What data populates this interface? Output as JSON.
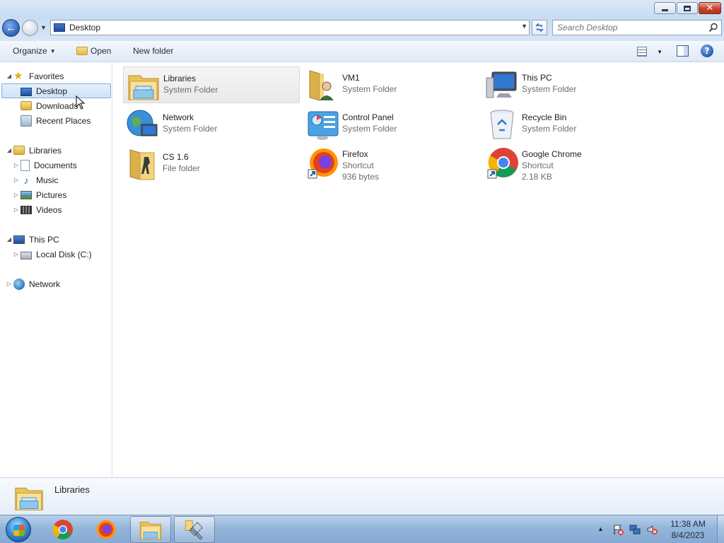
{
  "window": {
    "address": "Desktop",
    "search_placeholder": "Search Desktop"
  },
  "toolbar": {
    "organize_label": "Organize",
    "open_label": "Open",
    "new_folder_label": "New folder"
  },
  "navigation": {
    "favorites": {
      "label": "Favorites",
      "items": [
        {
          "label": "Desktop",
          "icon": "desktop-icon",
          "selected": true
        },
        {
          "label": "Downloads",
          "icon": "folder-icon"
        },
        {
          "label": "Recent Places",
          "icon": "recent-places-icon"
        }
      ]
    },
    "libraries": {
      "label": "Libraries",
      "items": [
        {
          "label": "Documents",
          "icon": "documents-icon"
        },
        {
          "label": "Music",
          "icon": "music-icon"
        },
        {
          "label": "Pictures",
          "icon": "pictures-icon"
        },
        {
          "label": "Videos",
          "icon": "videos-icon"
        }
      ]
    },
    "this_pc": {
      "label": "This PC",
      "items": [
        {
          "label": "Local Disk (C:)",
          "icon": "disk-icon"
        }
      ]
    },
    "network": {
      "label": "Network"
    }
  },
  "items": [
    {
      "name": "Libraries",
      "type": "System Folder",
      "icon": "libraries-icon",
      "selected": true
    },
    {
      "name": "VM1",
      "type": "System Folder",
      "icon": "user-folder-icon"
    },
    {
      "name": "This PC",
      "type": "System Folder",
      "icon": "computer-icon"
    },
    {
      "name": "Network",
      "type": "System Folder",
      "icon": "network-icon"
    },
    {
      "name": "Control Panel",
      "type": "System Folder",
      "icon": "control-panel-icon"
    },
    {
      "name": "Recycle Bin",
      "type": "System Folder",
      "icon": "recycle-bin-icon"
    },
    {
      "name": "CS 1.6",
      "type": "File folder",
      "icon": "game-folder-icon"
    },
    {
      "name": "Firefox",
      "type": "Shortcut",
      "size": "936 bytes",
      "icon": "firefox-icon"
    },
    {
      "name": "Google Chrome",
      "type": "Shortcut",
      "size": "2.18 KB",
      "icon": "chrome-icon"
    }
  ],
  "details_pane": {
    "name": "Libraries",
    "icon": "libraries-icon"
  },
  "taskbar": {
    "apps": [
      {
        "name": "Google Chrome",
        "icon": "chrome-icon"
      },
      {
        "name": "Firefox",
        "icon": "firefox-icon"
      },
      {
        "name": "Windows Explorer",
        "icon": "explorer-icon",
        "active": true
      },
      {
        "name": "Tools",
        "icon": "tools-icon",
        "active": true
      }
    ],
    "time": "11:38 AM",
    "date": "8/4/2023"
  },
  "colors": {
    "accent": "#2a63b8",
    "selection": "#cfe2f8"
  }
}
